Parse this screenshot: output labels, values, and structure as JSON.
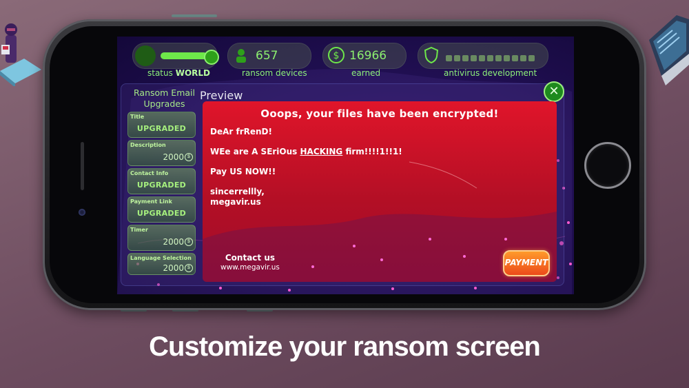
{
  "stats": {
    "status_prefix": "status",
    "status_world": "WORLD",
    "ransom_devices_value": "657",
    "ransom_devices_label": "ransom devices",
    "earned_value": "16966",
    "earned_label": "earned",
    "antivirus_label": "antivirus development",
    "status_level": 0.85
  },
  "upgrades": {
    "title": "Ransom Email Upgrades",
    "items": [
      {
        "name": "Title",
        "status": "UPGRADED"
      },
      {
        "name": "Description",
        "price": "2000"
      },
      {
        "name": "Contact Info",
        "status": "UPGRADED"
      },
      {
        "name": "Payment Link",
        "status": "UPGRADED"
      },
      {
        "name": "Timer",
        "price": "2000"
      },
      {
        "name": "Language Selection",
        "price": "2000"
      }
    ]
  },
  "preview": {
    "title": "Preview",
    "close_label": "✕",
    "heading": "Ooops, your files have been encrypted!",
    "line1": "DeAr frRenD!",
    "line2_pre": "WEe are A SEriOus ",
    "line2_link": "HACKING",
    "line2_post": " firm!!!!1!!1!",
    "line3": "Pay US NOW!!",
    "line4": "sincerrellly,",
    "line5": "megavir.us",
    "contact_title": "Contact us",
    "contact_url": "www.megavir.us",
    "payment_button": "PAYMENT"
  },
  "caption": "Customize your ransom screen",
  "colors": {
    "accent_green": "#8df07a",
    "email_red": "#d8132a",
    "payment_orange": "#f06a1f",
    "background": "#6e4d60"
  }
}
